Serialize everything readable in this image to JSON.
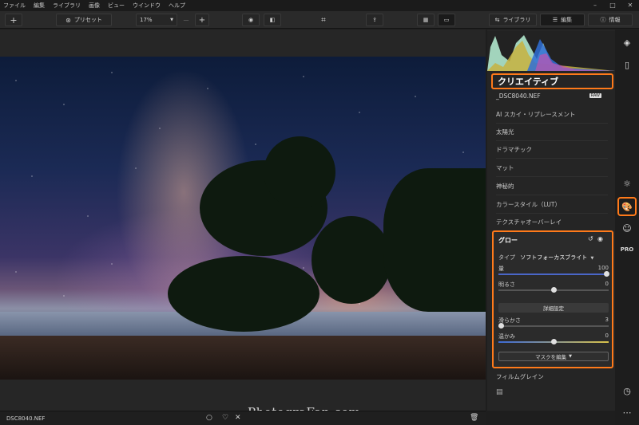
{
  "menu": [
    "ファイル",
    "編集",
    "ライブラリ",
    "画像",
    "ビュー",
    "ウインドウ",
    "ヘルプ"
  ],
  "window_controls": [
    "–",
    "□",
    "✕"
  ],
  "toolbar": {
    "add": "+",
    "presets": "プリセット",
    "zoom": "17%",
    "zoom_minus": "—",
    "zoom_plus": "+",
    "library_tab": "ライブラリ",
    "edit_tab": "編集",
    "info_tab": "情報"
  },
  "status": {
    "filename": "DSC8040.NEF",
    "rating_icon": "○",
    "heart": "♡",
    "reject": "✕",
    "stars": "☆☆☆☆☆"
  },
  "watermark": "PhotograFan.com",
  "panel": {
    "section_title": "クリエイティブ",
    "file": "_DSC8040.NEF",
    "raw_badge": "RAW",
    "items": [
      "AI スカイ・リプレースメント",
      "太陽光",
      "ドラマチック",
      "マット",
      "神秘的",
      "カラースタイル（LUT）",
      "テクスチャオーバーレイ"
    ],
    "glow": {
      "title": "グロー",
      "type_label": "タイプ",
      "type_value": "ソフトフォーカスブライト",
      "amount_label": "量",
      "amount_value": 100,
      "brightness_label": "明るさ",
      "brightness_value": 0,
      "detail_button": "詳細設定",
      "smoothness_label": "滑らかさ",
      "smoothness_value": 3,
      "warmth_label": "温かみ",
      "warmth_value": 0,
      "mask_button": "マスクを編集"
    },
    "film_grain": "フィルムグレイン"
  },
  "colors": {
    "accent": "#ff7a1a"
  }
}
